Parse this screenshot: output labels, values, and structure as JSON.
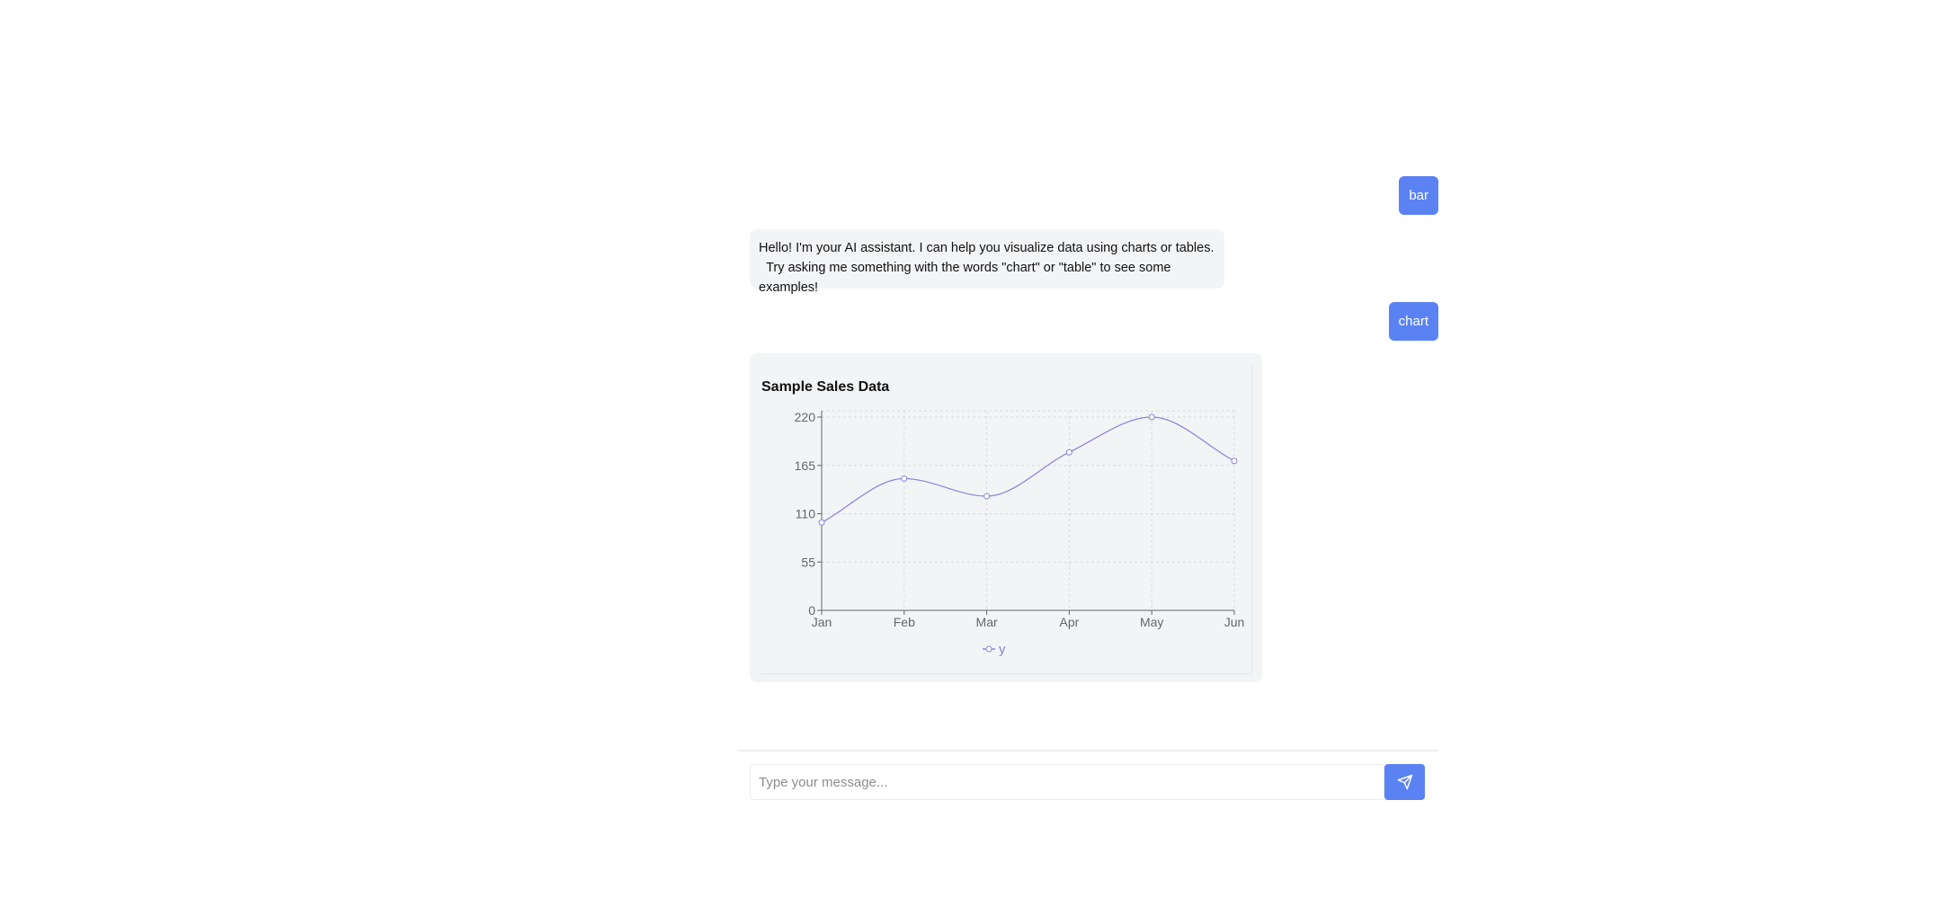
{
  "messages": [
    {
      "role": "user",
      "text": "bar"
    },
    {
      "role": "assistant",
      "text": "Hello! I'm your AI assistant. I can help you visualize data using charts or tables.\n  Try asking me something with the words \"chart\" or \"table\" to see some examples!"
    },
    {
      "role": "user",
      "text": "chart"
    }
  ],
  "chart_data": {
    "type": "line",
    "title": "Sample Sales Data",
    "categories": [
      "Jan",
      "Feb",
      "Mar",
      "Apr",
      "May",
      "Jun"
    ],
    "series": [
      {
        "name": "y",
        "values": [
          100,
          150,
          130,
          180,
          220,
          170
        ],
        "color": "#8884d8"
      }
    ],
    "y_ticks": [
      "0",
      "55",
      "110",
      "165",
      "220"
    ],
    "ylim": [
      0,
      220
    ],
    "xlabel": "",
    "ylabel": "",
    "grid": true,
    "legend_position": "bottom-center"
  },
  "composer": {
    "placeholder": "Type your message...",
    "value": "",
    "send_icon": "send-icon"
  },
  "colors": {
    "accent": "#5b82f3",
    "assistant_bubble": "#f3f4f6",
    "series_line": "#8884d8"
  }
}
